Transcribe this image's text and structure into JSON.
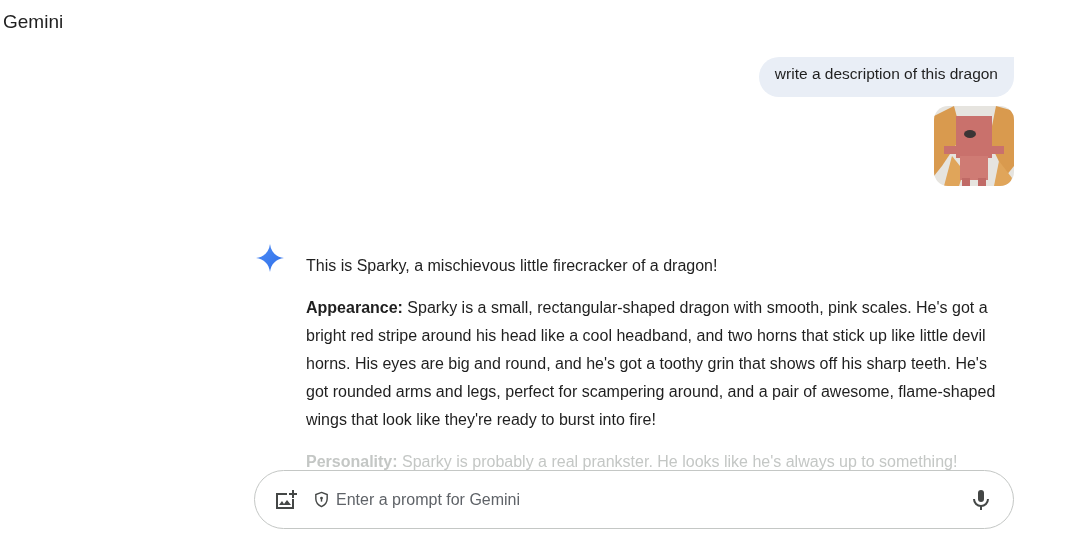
{
  "app_title": "Gemini",
  "user_message": {
    "text": "write a description of this dragon"
  },
  "response": {
    "paragraphs": [
      "This is Sparky, a mischievous little firecracker of a dragon!",
      "**Appearance:** Sparky is a small, rectangular-shaped dragon with smooth, pink scales.  He's got a bright red stripe around his head like a cool headband, and two horns that stick up like little devil horns.  His eyes are big and round, and he's got a toothy grin that shows off his sharp teeth.  He's got rounded arms and legs, perfect for scampering around, and a pair of awesome, flame-shaped wings that look like they're ready to burst into fire!",
      "**Personality:** Sparky is probably a real prankster.  He looks like he's always up to something!"
    ]
  },
  "prompt": {
    "placeholder": "Enter a prompt for Gemini"
  }
}
